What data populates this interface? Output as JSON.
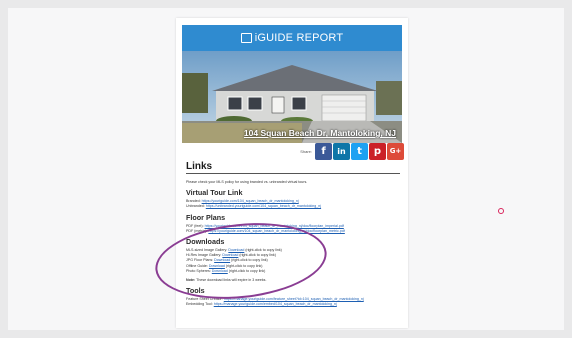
{
  "report": {
    "title": "iGUIDE REPORT",
    "hero_caption": "104 Squan Beach Dr, Mantoloking, NJ",
    "share_label": "Share:"
  },
  "social": {
    "facebook": "f",
    "linkedin": "in",
    "twitter": "t",
    "pinterest": "p",
    "googleplus": "G+"
  },
  "colors": {
    "header": "#2f8bd0",
    "facebook": "#3b5998",
    "linkedin": "#0e76a8",
    "twitter": "#1da1f2",
    "pinterest": "#cb2027",
    "googleplus": "#dd4b39",
    "highlight": "#8a3d93"
  },
  "links": {
    "heading": "Links",
    "policy_note": "Please check your MLS policy for using branded vs. unbranded virtual tours.",
    "virtual_tour": {
      "heading": "Virtual Tour Link",
      "branded_label": "Branded:",
      "branded_url": "https://youriguide.com/104_squan_beach_dr_mantoloking_nj",
      "unbranded_label": "Unbranded:",
      "unbranded_url": "https://unbranded.youriguide.com/104_squan_beach_dr_mantoloking_nj"
    },
    "floor_plans": {
      "heading": "Floor Plans",
      "pdf_imperial_label": "PDF (feet):",
      "pdf_imperial_url": "https://youriguide.com/104_squan_beach_dr_mantoloking_nj/doc/floorplan_imperial.pdf",
      "pdf_metric_label": "PDF (metric):",
      "pdf_metric_url": "https://youriguide.com/104_squan_beach_dr_mantoloking_nj/doc/floorplan_metric.pdf"
    },
    "downloads": {
      "heading": "Downloads",
      "items": [
        {
          "label": "MLS-sized Image Gallery:",
          "link": "Download",
          "hint": "(right-click to copy link)"
        },
        {
          "label": "Hi-Res Image Gallery:",
          "link": "Download",
          "hint": "(right-click to copy link)"
        },
        {
          "label": "JPG Floor Plans:",
          "link": "Download",
          "hint": "(right-click to copy link)"
        },
        {
          "label": "Offline Guide:",
          "link": "Download",
          "hint": "(right-click to copy link)"
        },
        {
          "label": "Photo Spheres:",
          "link": "Download",
          "hint": "(right-click to copy link)"
        }
      ],
      "note_label": "Note:",
      "note_text": "These download links will expire in 3 weeks."
    },
    "tools": {
      "heading": "Tools",
      "feature_label": "Feature Sheet Creator:",
      "feature_url": "https://manage.youriguide.com/feature_sheet?id=104_squan_beach_dr_mantoloking_nj",
      "embed_label": "Embedding Tool:",
      "embed_url": "https://manage.youriguide.com/embed/104_squan_beach_dr_mantoloking_nj"
    }
  }
}
